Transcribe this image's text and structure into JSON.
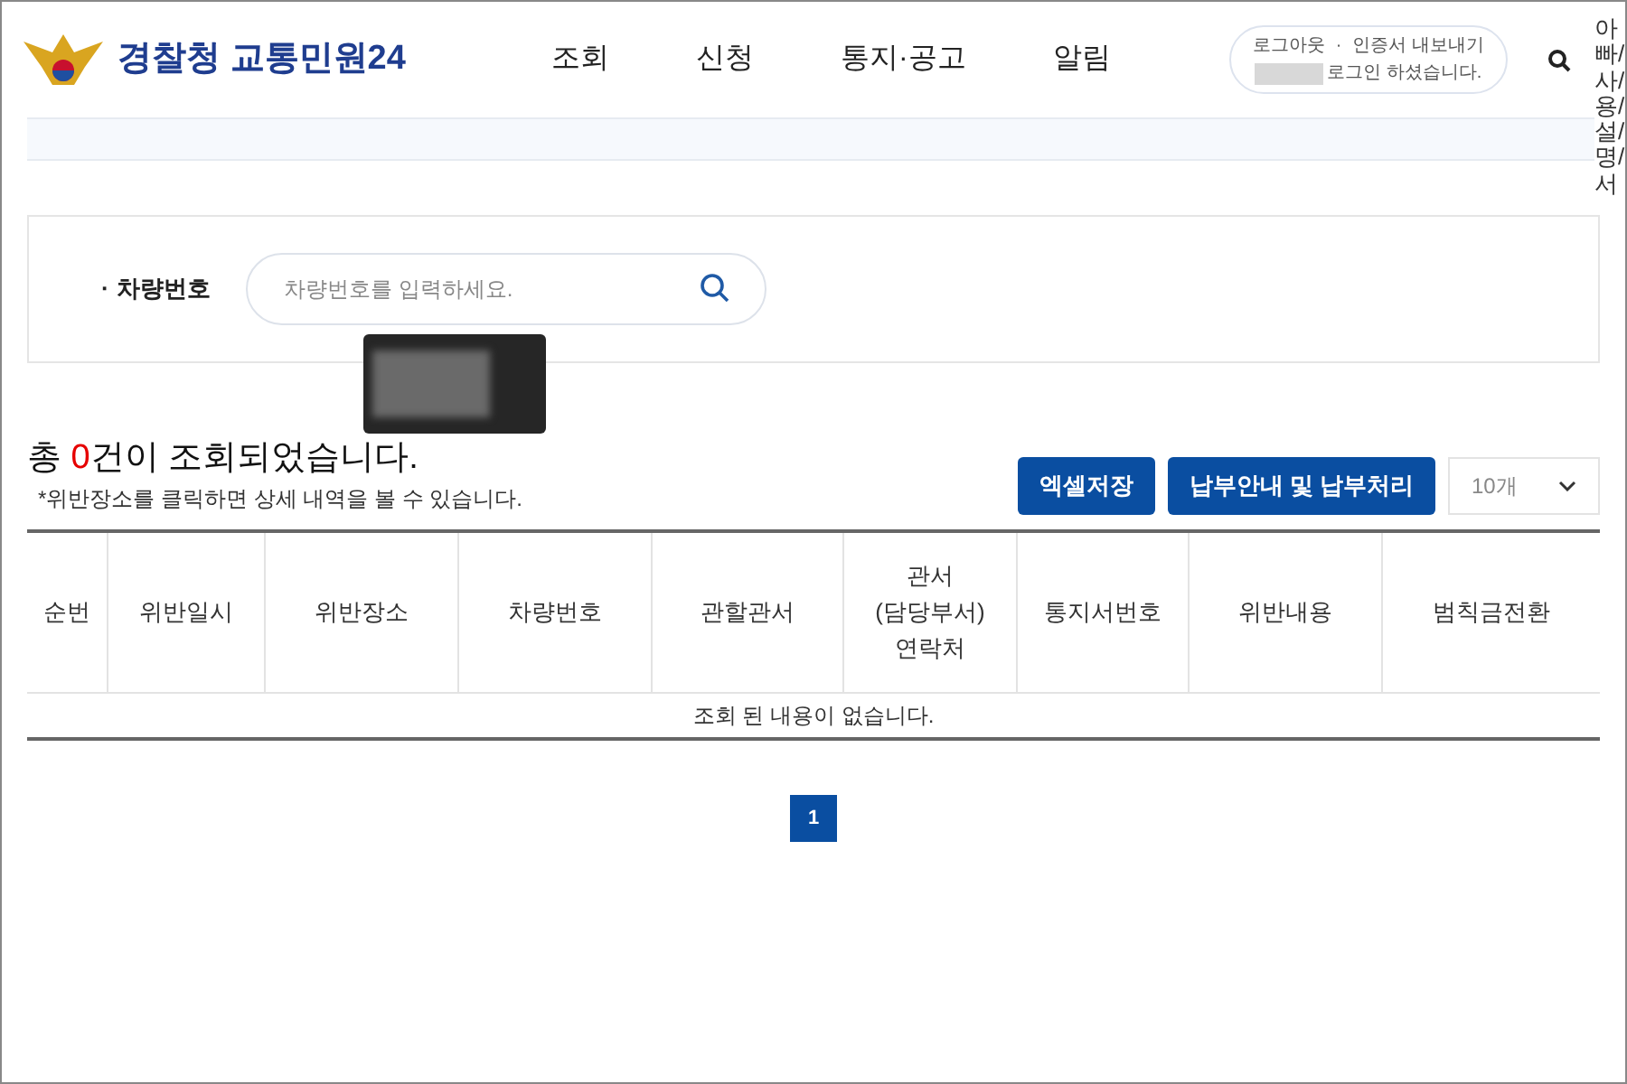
{
  "header": {
    "logo_text": "경찰청 교통민원24",
    "nav": [
      "조회",
      "신청",
      "통지·공고",
      "알림"
    ],
    "login_box": {
      "links": [
        "로그아웃",
        "인증서 내보내기"
      ],
      "separator": "·",
      "message": "로그인 하셨습니다."
    }
  },
  "side_label": "아빠/사/용/설/명/서",
  "search": {
    "bullet": "·",
    "label": "차량번호",
    "placeholder": "차량번호를 입력하세요."
  },
  "result": {
    "summary_before": "총 ",
    "count": "0",
    "summary_after": "건이 조회되었습니다.",
    "note": "*위반장소를 클릭하면 상세 내역을 볼 수 있습니다."
  },
  "buttons": [
    "엑셀저장",
    "납부안내 및 납부처리"
  ],
  "page_size": {
    "value": "10개"
  },
  "table": {
    "columns": [
      {
        "lines": [
          "순번"
        ]
      },
      {
        "lines": [
          "위반일시"
        ]
      },
      {
        "lines": [
          "위반장소"
        ]
      },
      {
        "lines": [
          "차량번호"
        ]
      },
      {
        "lines": [
          "관할관서"
        ]
      },
      {
        "lines": [
          "관서",
          "(담당부서)",
          "연락처"
        ]
      },
      {
        "lines": [
          "통지서번호"
        ]
      },
      {
        "lines": [
          "위반내용"
        ]
      },
      {
        "lines": [
          "범칙금전환"
        ]
      }
    ],
    "empty_message": "조회 된 내용이 없습니다."
  },
  "pagination": [
    {
      "label": "1",
      "selected": true
    }
  ]
}
